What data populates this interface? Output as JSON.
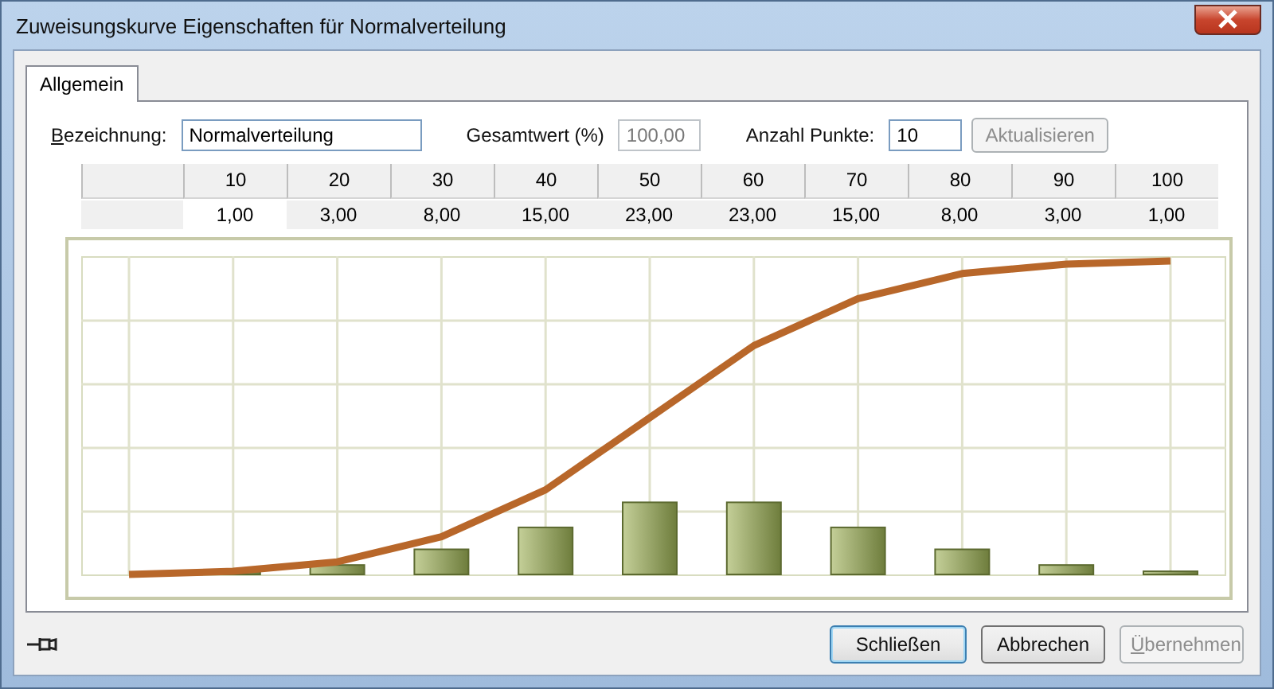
{
  "window": {
    "title": "Zuweisungskurve Eigenschaften für Normalverteilung"
  },
  "tabs": [
    {
      "label": "Allgemein",
      "selected": true
    }
  ],
  "form": {
    "name": {
      "label": "Bezeichnung:",
      "value": "Normalverteilung"
    },
    "total": {
      "label": "Gesamtwert (%)",
      "value": "100,00",
      "disabled": true
    },
    "points": {
      "label": "Anzahl Punkte:",
      "value": "10"
    },
    "update_button": {
      "label": "Aktualisieren",
      "disabled": true
    }
  },
  "table": {
    "columns": [
      "10",
      "20",
      "30",
      "40",
      "50",
      "60",
      "70",
      "80",
      "90",
      "100"
    ],
    "values": [
      "1,00",
      "3,00",
      "8,00",
      "15,00",
      "23,00",
      "23,00",
      "15,00",
      "8,00",
      "3,00",
      "1,00"
    ]
  },
  "buttons": [
    {
      "label": "Schließen",
      "disabled": false,
      "default": true
    },
    {
      "label": "Abbrechen",
      "disabled": false,
      "default": false
    },
    {
      "label": "Übernehmen",
      "disabled": true,
      "default": false
    }
  ]
}
